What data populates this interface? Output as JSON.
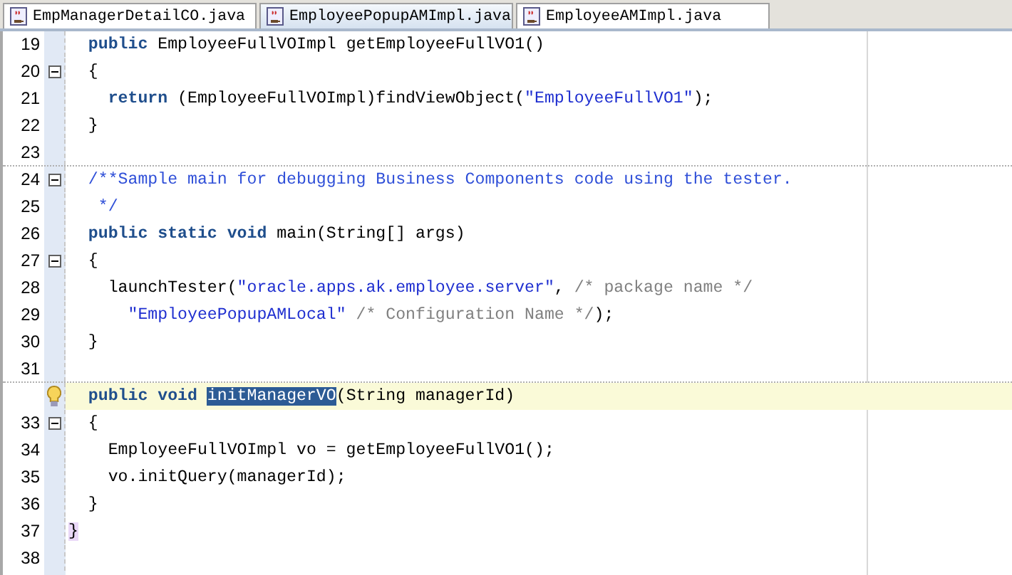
{
  "tabs": [
    {
      "label": "EmpManagerDetailCO.java",
      "selected": false
    },
    {
      "label": "EmployeePopupAMImpl.java",
      "selected": true
    },
    {
      "label": "EmployeeAMImpl.java",
      "selected": false
    }
  ],
  "lines": [
    {
      "number": "19",
      "kind": "plain",
      "current": false,
      "divider": false,
      "tokens": [
        {
          "kind": "keyword",
          "text": "  public"
        },
        {
          "kind": "plain",
          "text": " EmployeeFullVOImpl getEmployeeFullVO1()"
        }
      ]
    },
    {
      "number": "20",
      "kind": "fold",
      "current": false,
      "divider": false,
      "tokens": [
        {
          "kind": "plain",
          "text": "  {"
        }
      ]
    },
    {
      "number": "21",
      "kind": "plain",
      "current": false,
      "divider": false,
      "tokens": [
        {
          "kind": "keyword",
          "text": "    return"
        },
        {
          "kind": "plain",
          "text": " (EmployeeFullVOImpl)findViewObject("
        },
        {
          "kind": "string",
          "text": "\"EmployeeFullVO1\""
        },
        {
          "kind": "plain",
          "text": ");"
        }
      ]
    },
    {
      "number": "22",
      "kind": "plain",
      "current": false,
      "divider": false,
      "tokens": [
        {
          "kind": "plain",
          "text": "  }"
        }
      ]
    },
    {
      "number": "23",
      "kind": "plain",
      "current": false,
      "divider": true
    },
    {
      "number": "24",
      "kind": "fold",
      "current": false,
      "divider": false,
      "tokens": [
        {
          "kind": "doc",
          "text": "  /**Sample main for debugging Business Components code using the tester."
        }
      ]
    },
    {
      "number": "25",
      "kind": "plain",
      "current": false,
      "divider": false,
      "tokens": [
        {
          "kind": "doc",
          "text": "   */"
        }
      ]
    },
    {
      "number": "26",
      "kind": "plain",
      "current": false,
      "divider": false,
      "tokens": [
        {
          "kind": "keyword",
          "text": "  public static void"
        },
        {
          "kind": "plain",
          "text": " main(String[] args)"
        }
      ]
    },
    {
      "number": "27",
      "kind": "fold",
      "current": false,
      "divider": false,
      "tokens": [
        {
          "kind": "plain",
          "text": "  {"
        }
      ]
    },
    {
      "number": "28",
      "kind": "plain",
      "current": false,
      "divider": false,
      "tokens": [
        {
          "kind": "plain",
          "text": "    launchTester("
        },
        {
          "kind": "string",
          "text": "\"oracle.apps.ak.employee.server\""
        },
        {
          "kind": "plain",
          "text": ", "
        },
        {
          "kind": "comment",
          "text": "/* package name */"
        }
      ]
    },
    {
      "number": "29",
      "kind": "plain",
      "current": false,
      "divider": false,
      "tokens": [
        {
          "kind": "string",
          "text": "      \"EmployeePopupAMLocal\""
        },
        {
          "kind": "comment",
          "text": " /* Configuration Name */"
        },
        {
          "kind": "plain",
          "text": ");"
        }
      ]
    },
    {
      "number": "30",
      "kind": "plain",
      "current": false,
      "divider": false,
      "tokens": [
        {
          "kind": "plain",
          "text": "  }"
        }
      ]
    },
    {
      "number": "31",
      "kind": "plain",
      "current": false,
      "divider": true
    },
    {
      "kind": "bulb",
      "current": true,
      "divider": false,
      "tokens": [
        {
          "kind": "keyword",
          "text": "  public void "
        },
        {
          "kind": "selection",
          "text": "initManagerVO"
        },
        {
          "kind": "plain",
          "text": "(String managerId)"
        }
      ]
    },
    {
      "number": "33",
      "kind": "fold",
      "current": false,
      "divider": false,
      "tokens": [
        {
          "kind": "plain",
          "text": "  {"
        }
      ]
    },
    {
      "number": "34",
      "kind": "plain",
      "current": false,
      "divider": false,
      "tokens": [
        {
          "kind": "plain",
          "text": "    EmployeeFullVOImpl vo = getEmployeeFullVO1();"
        }
      ]
    },
    {
      "number": "35",
      "kind": "plain",
      "current": false,
      "divider": false,
      "tokens": [
        {
          "kind": "plain",
          "text": "    vo.initQuery(managerId);"
        }
      ]
    },
    {
      "number": "36",
      "kind": "plain",
      "current": false,
      "divider": false,
      "tokens": [
        {
          "kind": "plain",
          "text": "  }"
        }
      ]
    },
    {
      "number": "37",
      "kind": "plain",
      "current": false,
      "divider": false,
      "tokens": [
        {
          "kind": "match",
          "text": "}"
        }
      ]
    },
    {
      "number": "38",
      "kind": "plain",
      "current": false,
      "divider": false
    }
  ]
}
